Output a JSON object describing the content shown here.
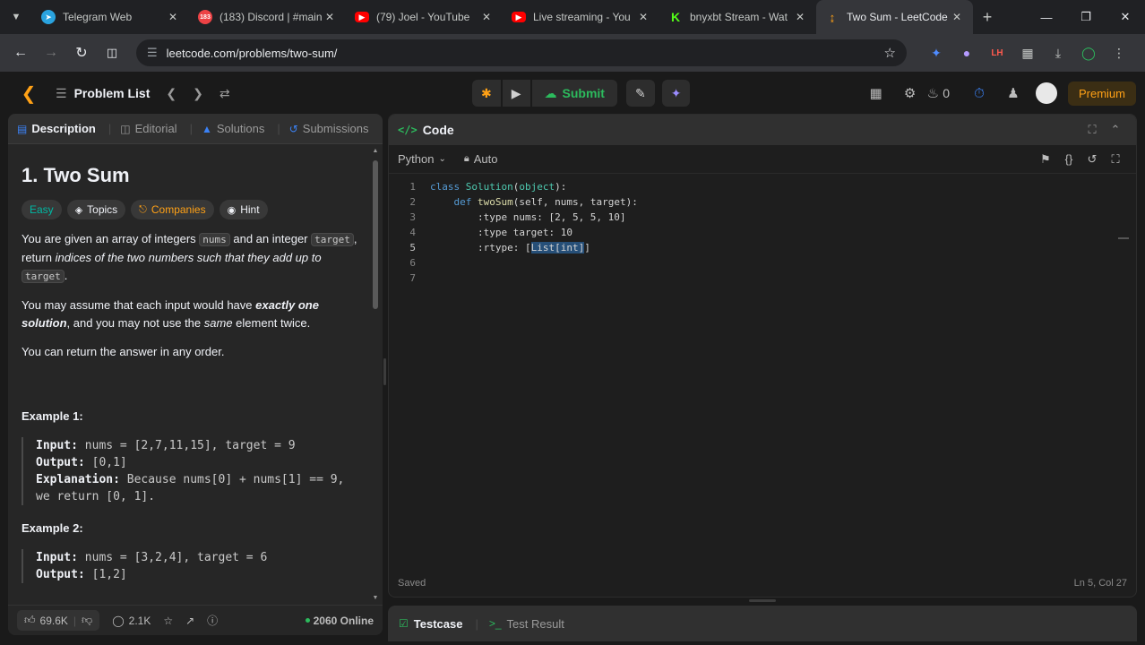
{
  "browser": {
    "tabs": [
      {
        "label": "Telegram Web",
        "icon": "telegram-icon",
        "badge": "",
        "color": "#2aa3df"
      },
      {
        "label": "(183) Discord | #main",
        "icon": "discord-icon",
        "badge": "183",
        "color": "#ed4245"
      },
      {
        "label": "(79) Joel - YouTube",
        "icon": "youtube-icon",
        "badge": "",
        "color": "#ff0000"
      },
      {
        "label": "Live streaming - You",
        "icon": "youtube-icon",
        "badge": "",
        "color": "#ff0000"
      },
      {
        "label": "bnyxbt Stream - Wat",
        "icon": "kick-icon",
        "badge": "K",
        "color": "#53fc18"
      },
      {
        "label": "Two Sum - LeetCode",
        "icon": "leetcode-icon",
        "badge": "",
        "color": "#ffa116"
      }
    ],
    "url": "leetcode.com/problems/two-sum/"
  },
  "header": {
    "problem_list": "Problem List",
    "submit": "Submit",
    "streak": "0",
    "premium": "Premium"
  },
  "left": {
    "tabs": [
      "Description",
      "Editorial",
      "Solutions",
      "Submissions"
    ],
    "title": "1. Two Sum",
    "tags": [
      "Easy",
      "Topics",
      "Companies",
      "Hint"
    ],
    "desc": {
      "p1_a": "You are given an array of integers ",
      "p1_code1": "nums",
      "p1_b": " and an integer ",
      "p1_code2": "target",
      "p1_c": ", return ",
      "p1_em": "indices of the two numbers such that they add up to",
      "p1_code3": "target",
      "p1_d": ".",
      "p2_a": "You may assume that each input would have ",
      "p2_em": "exactly one solution",
      "p2_b": ", and you may not use the ",
      "p2_em2": "same",
      "p2_c": " element twice.",
      "p3": "You can return the answer in any order."
    },
    "ex1_title": "Example 1:",
    "ex1": {
      "input_label": "Input:",
      "input": " nums = [2,7,11,15], target = 9",
      "output_label": "Output:",
      "output": " [0,1]",
      "expl_label": "Explanation:",
      "expl": " Because nums[0] + nums[1] == 9, we return [0, 1]."
    },
    "ex2_title": "Example 2:",
    "ex2": {
      "input_label": "Input:",
      "input": " nums = [3,2,4], target = 6",
      "output_label": "Output:",
      "output": " [1,2]"
    },
    "footer": {
      "likes": "69.6K",
      "comments": "2.1K",
      "online": "2060 Online"
    }
  },
  "code": {
    "title": "Code",
    "language": "Python",
    "mode": "Auto",
    "line_numbers": [
      "1",
      "2",
      "3",
      "4",
      "5",
      "6",
      "7"
    ],
    "status": "Saved",
    "cursor": "Ln 5, Col 27"
  },
  "bottom": {
    "tabs": [
      "Testcase",
      "Test Result"
    ]
  }
}
